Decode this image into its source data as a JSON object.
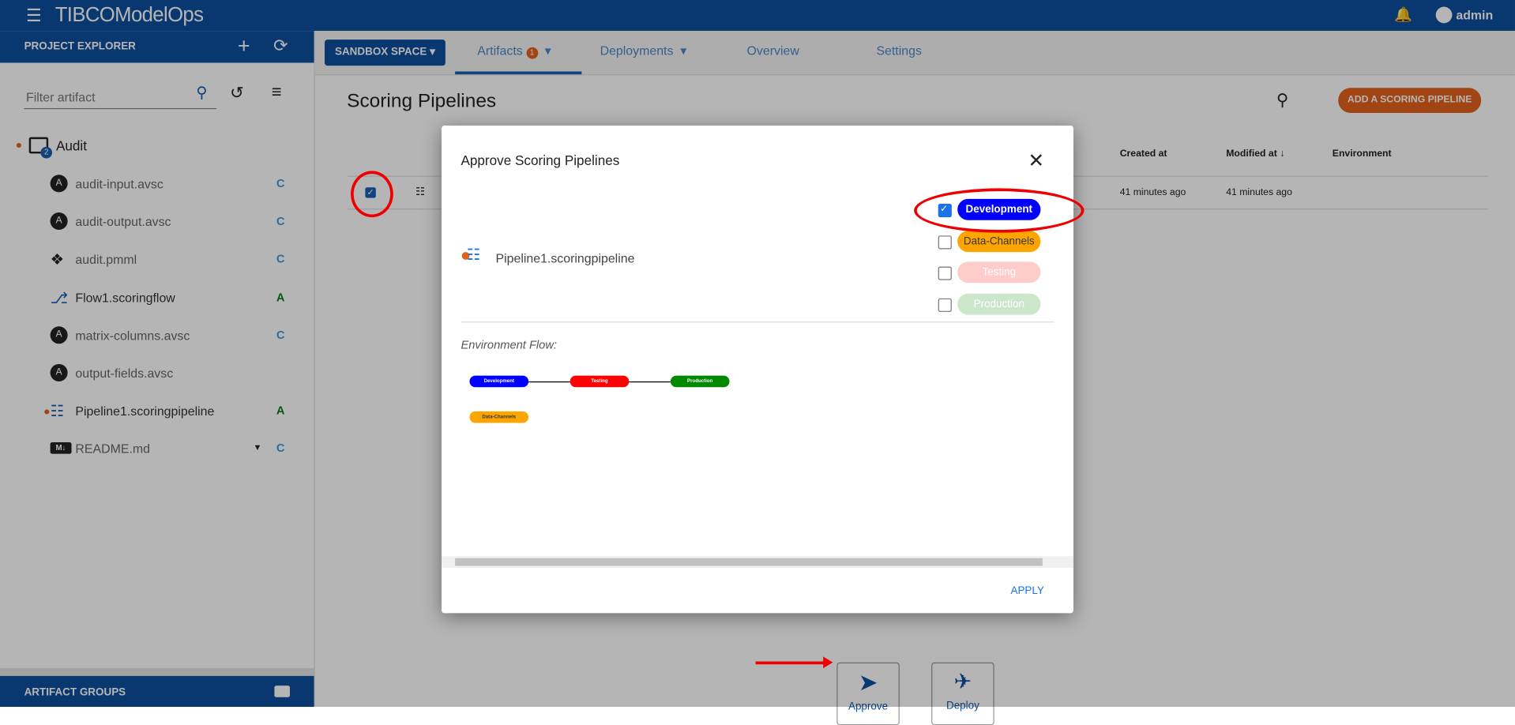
{
  "header": {
    "brand": "TIBCO",
    "product": "ModelOps",
    "user": "admin"
  },
  "sidebar": {
    "title": "PROJECT EXPLORER",
    "filter_placeholder": "Filter artifact",
    "project": {
      "name": "Audit",
      "badge": "2"
    },
    "items": [
      {
        "label": "audit-input.avsc",
        "status": "C",
        "icon": "avro-icon"
      },
      {
        "label": "audit-output.avsc",
        "status": "C",
        "icon": "avro-icon"
      },
      {
        "label": "audit.pmml",
        "status": "C",
        "icon": "pmml-icon"
      },
      {
        "label": "Flow1.scoringflow",
        "status": "A",
        "icon": "scoringflow-icon"
      },
      {
        "label": "matrix-columns.avsc",
        "status": "C",
        "icon": "avro-icon"
      },
      {
        "label": "output-fields.avsc",
        "status": "",
        "icon": "avro-icon"
      },
      {
        "label": "Pipeline1.scoringpipeline",
        "status": "A",
        "icon": "pipeline-icon"
      },
      {
        "label": "README.md",
        "status": "C",
        "icon": "markdown-icon"
      }
    ],
    "footer": "ARTIFACT GROUPS"
  },
  "topbar": {
    "space": "SANDBOX SPACE",
    "tabs": [
      {
        "label": "Artifacts",
        "badge": "1"
      },
      {
        "label": "Deployments"
      },
      {
        "label": "Overview"
      },
      {
        "label": "Settings"
      }
    ]
  },
  "main": {
    "title": "Scoring Pipelines",
    "add_button": "ADD A SCORING PIPELINE",
    "columns": [
      "Created at",
      "Modified at",
      "Environment"
    ],
    "row": {
      "created": "41 minutes ago",
      "modified": "41 minutes ago"
    },
    "actions": {
      "approve": "Approve",
      "deploy": "Deploy"
    }
  },
  "dialog": {
    "title": "Approve Scoring Pipelines",
    "pipeline": "Pipeline1.scoringpipeline",
    "environments": [
      {
        "label": "Development",
        "checked": true,
        "color": "#0000ff"
      },
      {
        "label": "Data-Channels",
        "checked": false,
        "color": "#ffa500"
      },
      {
        "label": "Testing",
        "checked": false,
        "color": "#ffcccc"
      },
      {
        "label": "Production",
        "checked": false,
        "color": "#cce6cc"
      }
    ],
    "flow_label": "Environment Flow:",
    "flow": {
      "development": "Development",
      "testing": "Testing",
      "production": "Production",
      "data_channels": "Data-Channels"
    },
    "apply": "APPLY"
  }
}
